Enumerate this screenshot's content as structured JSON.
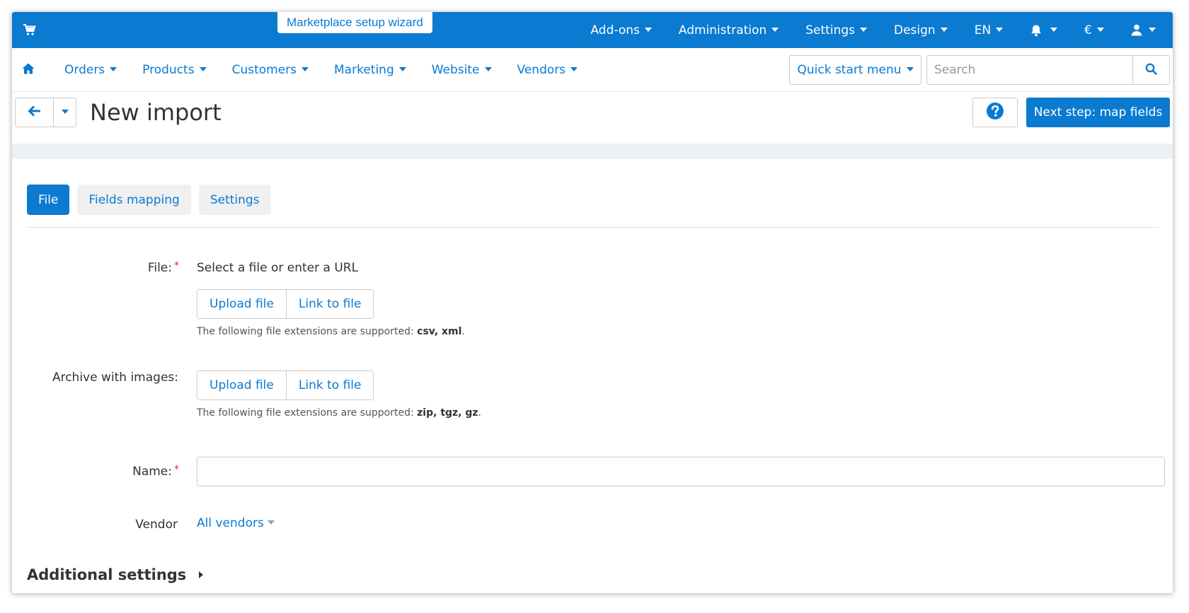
{
  "topbar": {
    "wizard_label": "Marketplace setup wizard",
    "items": [
      {
        "label": "Add-ons"
      },
      {
        "label": "Administration"
      },
      {
        "label": "Settings"
      },
      {
        "label": "Design"
      },
      {
        "label": "EN"
      },
      {
        "label": ""
      },
      {
        "label": "€"
      },
      {
        "label": ""
      }
    ]
  },
  "nav": {
    "items": [
      {
        "label": "Orders"
      },
      {
        "label": "Products"
      },
      {
        "label": "Customers"
      },
      {
        "label": "Marketing"
      },
      {
        "label": "Website"
      },
      {
        "label": "Vendors"
      }
    ],
    "quick_start_label": "Quick start menu",
    "search_placeholder": "Search"
  },
  "header": {
    "title": "New import",
    "next_button_label": "Next step: map fields"
  },
  "tabs": [
    {
      "label": "File",
      "active": true
    },
    {
      "label": "Fields mapping",
      "active": false
    },
    {
      "label": "Settings",
      "active": false
    }
  ],
  "form": {
    "file_label": "File:",
    "file_prompt": "Select a file or enter a URL",
    "upload_label": "Upload file",
    "link_label": "Link to file",
    "file_hint_prefix": "The following file extensions are supported: ",
    "file_hint_ext": "csv, xml",
    "archive_label": "Archive with images:",
    "archive_hint_prefix": "The following file extensions are supported: ",
    "archive_hint_ext": "zip, tgz, gz",
    "name_label": "Name:",
    "name_value": "",
    "vendor_label": "Vendor",
    "vendor_value": "All vendors",
    "required_mark": "*",
    "period": "."
  },
  "additional_settings_label": "Additional settings",
  "colors": {
    "brand_blue": "#0b7ad1",
    "required_red": "#e02b2b"
  }
}
